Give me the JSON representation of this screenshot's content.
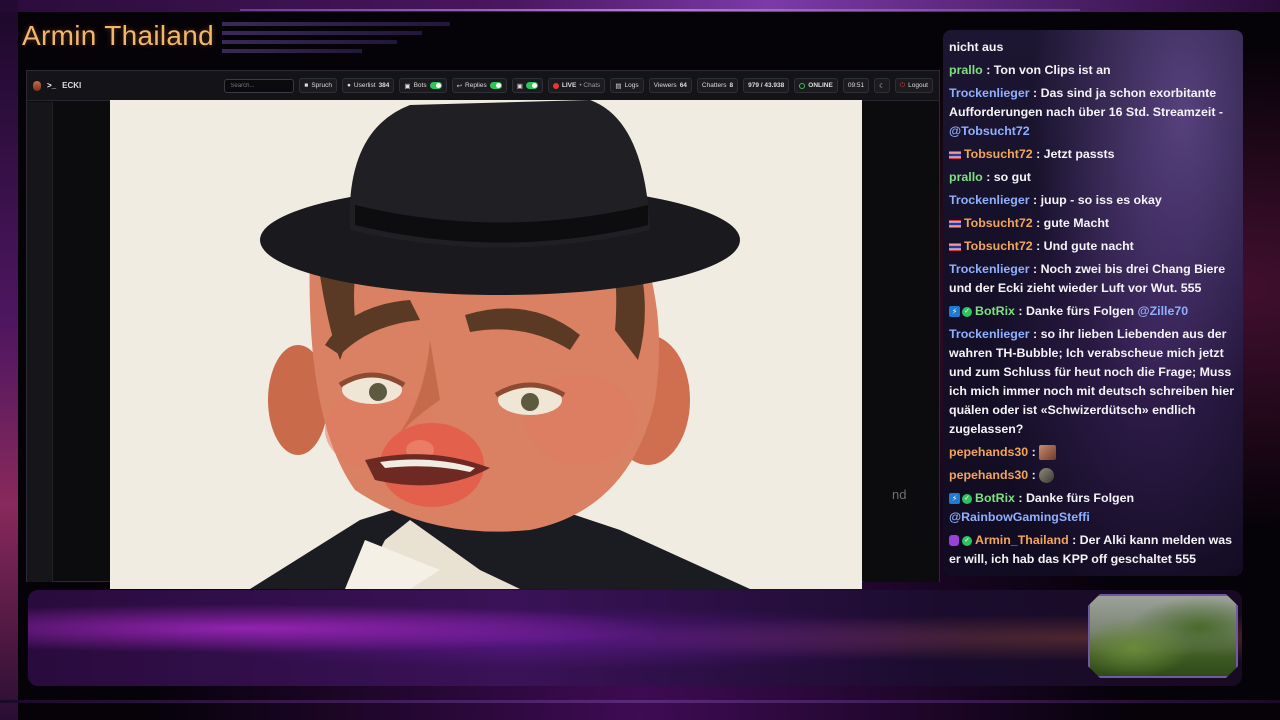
{
  "overlay": {
    "streamer_name": "Armin Thailand"
  },
  "dashboard": {
    "channel_name": "ECKI",
    "search_placeholder": "Search...",
    "spruch_label": "Spruch",
    "userlist_label": "Userlist",
    "userlist_count": "384",
    "bots_label": "Bots",
    "replies_label": "Replies",
    "live_label": "LIVE",
    "chats_label": "• Chats",
    "logs_label": "Logs",
    "viewers_label": "Viewers",
    "viewers_count": "64",
    "chatters_label": "Chatters",
    "chatters_count": "8",
    "ratio": "979 / 43.938",
    "online_label": "ONLINE",
    "time": "09:51",
    "logout_label": "Logout",
    "clipped_text": "nd"
  },
  "chat": {
    "messages": [
      {
        "user": "",
        "text": "nicht aus"
      },
      {
        "user": "prallo",
        "user_color": "#7ee07e",
        "text": "Ton von Clips ist an"
      },
      {
        "user": "Trockenlieger",
        "user_color": "#8fb0ff",
        "text": "Das sind ja schon exorbitante Aufforderungen nach über 16 Std. Streamzeit -",
        "mention": "@Tobsucht72"
      },
      {
        "user": "Tobsucht72",
        "user_color": "#f2a55a",
        "flag": true,
        "text": "Jetzt passts"
      },
      {
        "user": "prallo",
        "user_color": "#7ee07e",
        "text": "so gut"
      },
      {
        "user": "Trockenlieger",
        "user_color": "#8fb0ff",
        "text": "juup - so iss es okay"
      },
      {
        "user": "Tobsucht72",
        "user_color": "#f2a55a",
        "flag": true,
        "text": "gute Macht"
      },
      {
        "user": "Tobsucht72",
        "user_color": "#f2a55a",
        "flag": true,
        "text": "Und gute nacht"
      },
      {
        "user": "Trockenlieger",
        "user_color": "#8fb0ff",
        "text": "Noch zwei bis drei Chang Biere und der Ecki zieht wieder Luft vor Wut. 555"
      },
      {
        "user": "BotRix",
        "user_color": "#7ee07e",
        "bot": true,
        "text": "Danke fürs Folgen",
        "mention": "@Zille70"
      },
      {
        "user": "Trockenlieger",
        "user_color": "#8fb0ff",
        "text": "so ihr lieben Liebenden aus der wahren TH-Bubble; Ich verabscheue mich jetzt und zum Schluss für heut noch die Frage; Muss ich mich immer noch mit deutsch schreiben hier quälen oder ist «Schwizerdütsch» endlich zugelassen?"
      },
      {
        "user": "pepehands30",
        "user_color": "#f2a55a",
        "text": "",
        "emote": "a"
      },
      {
        "user": "pepehands30",
        "user_color": "#f2a55a",
        "text": "",
        "emote": "b"
      },
      {
        "user": "BotRix",
        "user_color": "#7ee07e",
        "bot": true,
        "text": "Danke fürs Folgen",
        "mention": "@RainbowGamingSteffi"
      },
      {
        "user": "Armin_Thailand",
        "user_color": "#f2a55a",
        "mic": true,
        "text": "Der Alki kann melden was er will, ich hab das KPP off geschaltet 555"
      }
    ]
  }
}
